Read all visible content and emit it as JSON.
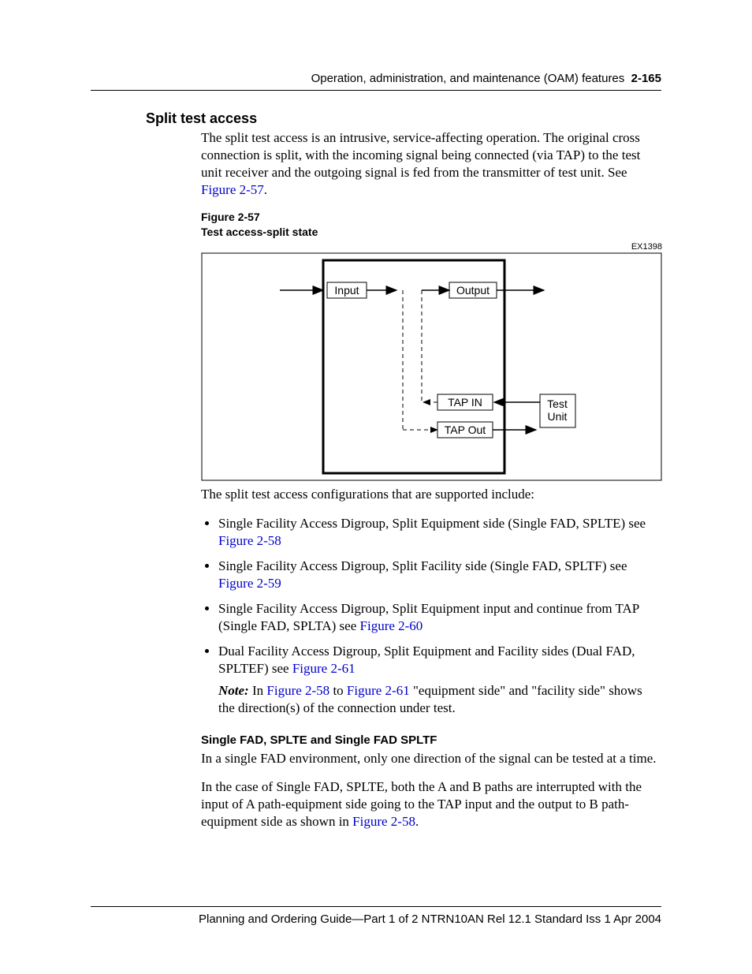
{
  "header": {
    "title": "Operation, administration, and maintenance (OAM) features",
    "pageno": "2-165"
  },
  "section": {
    "title": "Split test access",
    "para1_a": "The split test access is an intrusive, service-affecting operation. The original cross connection is split, with the incoming signal being connected (via TAP) to the test unit receiver and the outgoing signal is fed from the transmitter of test unit. See ",
    "para1_link": "Figure 2-57",
    "para1_b": "."
  },
  "figure": {
    "num": "Figure 2-57",
    "title": "Test access-split state",
    "code": "EX1398",
    "labels": {
      "input": "Input",
      "output": "Output",
      "tapin": "TAP IN",
      "tapout": "TAP Out",
      "testunit1": "Test",
      "testunit2": "Unit"
    }
  },
  "after_fig_para": "The split test access configurations that are supported include:",
  "bullets": [
    {
      "text_a": "Single Facility Access Digroup, Split Equipment side (Single FAD, SPLTE) see ",
      "link": "Figure 2-58",
      "text_b": ""
    },
    {
      "text_a": "Single Facility Access Digroup, Split Facility side (Single FAD, SPLTF) see ",
      "link": "Figure 2-59",
      "text_b": ""
    },
    {
      "text_a": "Single Facility Access Digroup, Split Equipment input and continue from TAP (Single FAD, SPLTA) see ",
      "link": "Figure 2-60",
      "text_b": ""
    },
    {
      "text_a": "Dual Facility Access Digroup, Split Equipment and Facility sides (Dual FAD, SPLTEF) see ",
      "link": "Figure 2-61",
      "text_b": ""
    }
  ],
  "note": {
    "label": "Note:",
    "a": "  In ",
    "link1": "Figure 2-58",
    "mid": " to ",
    "link2": "Figure 2-61",
    "b": " \"equipment side\" and \"facility side\" shows the direction(s) of the connection under test."
  },
  "subsection": {
    "title": "Single FAD, SPLTE and Single FAD SPLTF",
    "p1": "In a single FAD environment, only one direction of the signal can be tested at a time.",
    "p2_a": "In the case of Single FAD, SPLTE, both the A and B paths are interrupted with the input of A path-equipment side going to the TAP input and the output to B path-equipment side as shown in ",
    "p2_link": "Figure 2-58",
    "p2_b": "."
  },
  "footer": "Planning and Ordering Guide—Part 1 of 2   NTRN10AN   Rel 12.1  Standard   Iss 1   Apr 2004"
}
